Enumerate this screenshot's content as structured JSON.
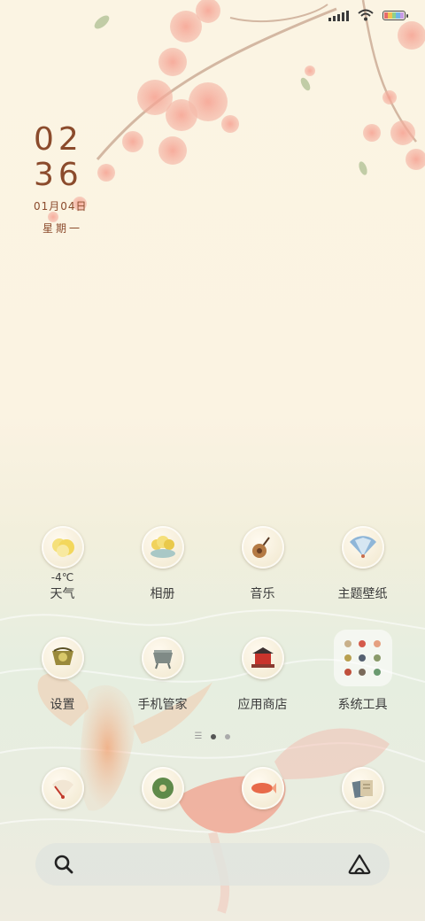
{
  "status": {
    "icons": [
      "signal-icon",
      "wifi-icon",
      "battery-icon"
    ]
  },
  "clock": {
    "hours": "02",
    "minutes": "36",
    "date": "01月04日",
    "weekday": "星期一"
  },
  "apps_row1": [
    {
      "name": "weather",
      "label": "天气",
      "temp": "-4℃",
      "icon": "weather-icon"
    },
    {
      "name": "gallery",
      "label": "相册",
      "icon": "gallery-icon"
    },
    {
      "name": "music",
      "label": "音乐",
      "icon": "music-icon"
    },
    {
      "name": "themes",
      "label": "主题壁纸",
      "icon": "theme-icon"
    }
  ],
  "apps_row2": [
    {
      "name": "settings",
      "label": "设置",
      "icon": "settings-icon"
    },
    {
      "name": "phone-manager",
      "label": "手机管家",
      "icon": "phone-manager-icon"
    },
    {
      "name": "app-store",
      "label": "应用商店",
      "icon": "app-store-icon"
    },
    {
      "name": "system-tools",
      "label": "系统工具",
      "icon": "folder-icon"
    }
  ],
  "dock": [
    "fan-icon",
    "compass-icon",
    "fish-icon",
    "books-icon"
  ],
  "search": {
    "left_icon": "search-icon",
    "right_icon": "assistant-icon"
  },
  "colors": {
    "clock": "#8b4b2c",
    "label": "#3b3b3b",
    "blossom": "#f08a7a"
  }
}
